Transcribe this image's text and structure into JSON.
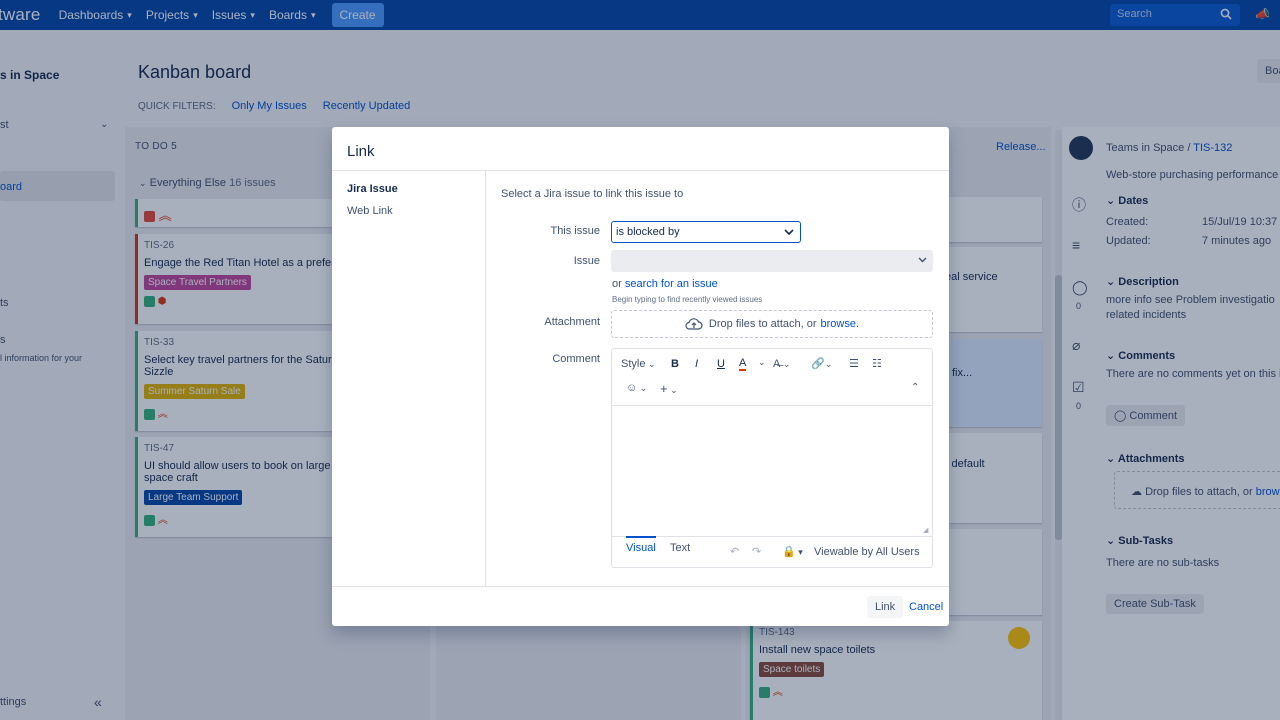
{
  "topnav": {
    "brand": "tware",
    "items": [
      "Dashboards",
      "Projects",
      "Issues",
      "Boards"
    ],
    "create": "Create",
    "search_placeholder": "Search"
  },
  "sidebar": {
    "project_name": "s in Space",
    "item1": "st",
    "item_active": "oard",
    "item3": "ts",
    "item4": "s",
    "item5": "l information for your",
    "item_bottom": "ttings"
  },
  "board": {
    "title": "Kanban board",
    "quick_filters_label": "QUICK FILTERS:",
    "filters": [
      "Only My Issues",
      "Recently Updated"
    ],
    "board_btn": "Boa",
    "todo_header": "TO DO",
    "todo_count": "5",
    "swimlane_name": "Everything Else",
    "swimlane_count": "16 issues",
    "release": "Release...",
    "cards": [
      {
        "key": "TIS-26",
        "summary": "Engage the Red Titan Hotel as a preferre",
        "tag": "Space Travel Partners"
      },
      {
        "key": "TIS-33",
        "summary": "Select key travel partners for the Saturn S",
        "summary2": "Sizzle",
        "tag": "Summer Saturn Sale"
      },
      {
        "key": "TIS-47",
        "summary": "UI should allow users to book on large o",
        "summary2": "space craft",
        "tag": "Large Team Support"
      }
    ],
    "right_cards": {
      "c1": "eal service",
      "c2": "fix...",
      "c3": "y default",
      "c4_key": "TIS-143",
      "c4_summary": "Install new space toilets",
      "c4_tag": "Space toilets"
    }
  },
  "details": {
    "project": "Teams in Space",
    "separator": "/",
    "issue_key": "TIS-132",
    "summary": "Web-store purchasing performance i",
    "dates_head": "Dates",
    "created_label": "Created:",
    "created_value": "15/Jul/19 10:37 P",
    "updated_label": "Updated:",
    "updated_value": "7 minutes ago",
    "description_head": "Description",
    "description_line1": "more info   see Problem investigatio",
    "description_line2": "related incidents",
    "comments_head": "Comments",
    "comments_text": "There are no comments yet on this is",
    "comment_btn": "Comment",
    "attachments_head": "Attachments",
    "attachments_drop": "Drop files to attach, or",
    "attachments_browse": "brow",
    "subtasks_head": "Sub-Tasks",
    "subtasks_text": "There are no sub-tasks",
    "create_subtask": "Create Sub-Task",
    "count_comments": "0",
    "count_checks": "0"
  },
  "dialog": {
    "title": "Link",
    "nav": [
      "Jira Issue",
      "Web Link"
    ],
    "intro": "Select a Jira issue to link this issue to",
    "this_issue_label": "This issue",
    "this_issue_value": "is blocked by",
    "issue_label": "Issue",
    "search_prefix": "or",
    "search_link": "search for an issue",
    "hint": "Begin typing to find recently viewed issues",
    "attachment_label": "Attachment",
    "drop_text": "Drop files to attach, or",
    "browse": "browse.",
    "comment_label": "Comment",
    "toolbar": {
      "style": "Style",
      "bold": "B",
      "italic": "I",
      "underline": "U",
      "color": "A"
    },
    "tab_visual": "Visual",
    "tab_text": "Text",
    "viewable": "Viewable by All Users",
    "link_btn": "Link",
    "cancel_btn": "Cancel"
  }
}
